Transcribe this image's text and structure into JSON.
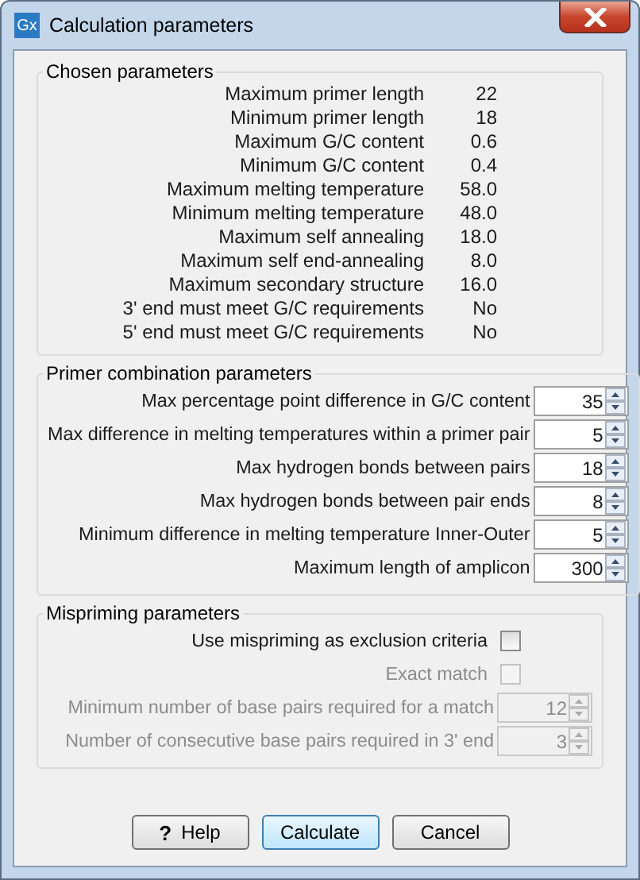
{
  "window": {
    "app_icon": "Gx",
    "title": "Calculation parameters"
  },
  "chosen_parameters": {
    "title": "Chosen parameters",
    "rows": [
      {
        "label": "Maximum primer length",
        "value": "22"
      },
      {
        "label": "Minimum primer length",
        "value": "18"
      },
      {
        "label": "Maximum G/C content",
        "value": "0.6"
      },
      {
        "label": "Minimum G/C content",
        "value": "0.4"
      },
      {
        "label": "Maximum melting temperature",
        "value": "58.0"
      },
      {
        "label": "Minimum melting temperature",
        "value": "48.0"
      },
      {
        "label": "Maximum self annealing",
        "value": "18.0"
      },
      {
        "label": "Maximum self end-annealing",
        "value": "8.0"
      },
      {
        "label": "Maximum secondary structure",
        "value": "16.0"
      },
      {
        "label": "3' end must meet G/C requirements",
        "value": "No"
      },
      {
        "label": "5' end must meet G/C requirements",
        "value": "No"
      }
    ]
  },
  "primer_combination_parameters": {
    "title": "Primer combination parameters",
    "rows": [
      {
        "label": "Max percentage point difference in G/C content",
        "value": "35"
      },
      {
        "label": "Max difference in melting temperatures within a primer pair",
        "value": "5"
      },
      {
        "label": "Max hydrogen bonds between pairs",
        "value": "18"
      },
      {
        "label": "Max hydrogen bonds between pair ends",
        "value": "8"
      },
      {
        "label": "Minimum difference in melting temperature Inner-Outer",
        "value": "5"
      },
      {
        "label": "Maximum length of amplicon",
        "value": "300"
      }
    ]
  },
  "mispriming_parameters": {
    "title": "Mispriming parameters",
    "rows": [
      {
        "kind": "checkbox",
        "label": "Use mispriming as exclusion criteria",
        "checked": false,
        "disabled": false
      },
      {
        "kind": "checkbox",
        "label": "Exact match",
        "checked": false,
        "disabled": true
      },
      {
        "kind": "spinner",
        "label": "Minimum number of base pairs required for a match",
        "value": "12",
        "disabled": true
      },
      {
        "kind": "spinner",
        "label": "Number of consecutive base pairs required in 3' end",
        "value": "3",
        "disabled": true
      }
    ]
  },
  "buttons": [
    {
      "label": "Help",
      "glyph": "?",
      "default": false
    },
    {
      "label": "Calculate",
      "default": true
    },
    {
      "label": "Cancel",
      "default": false
    }
  ]
}
